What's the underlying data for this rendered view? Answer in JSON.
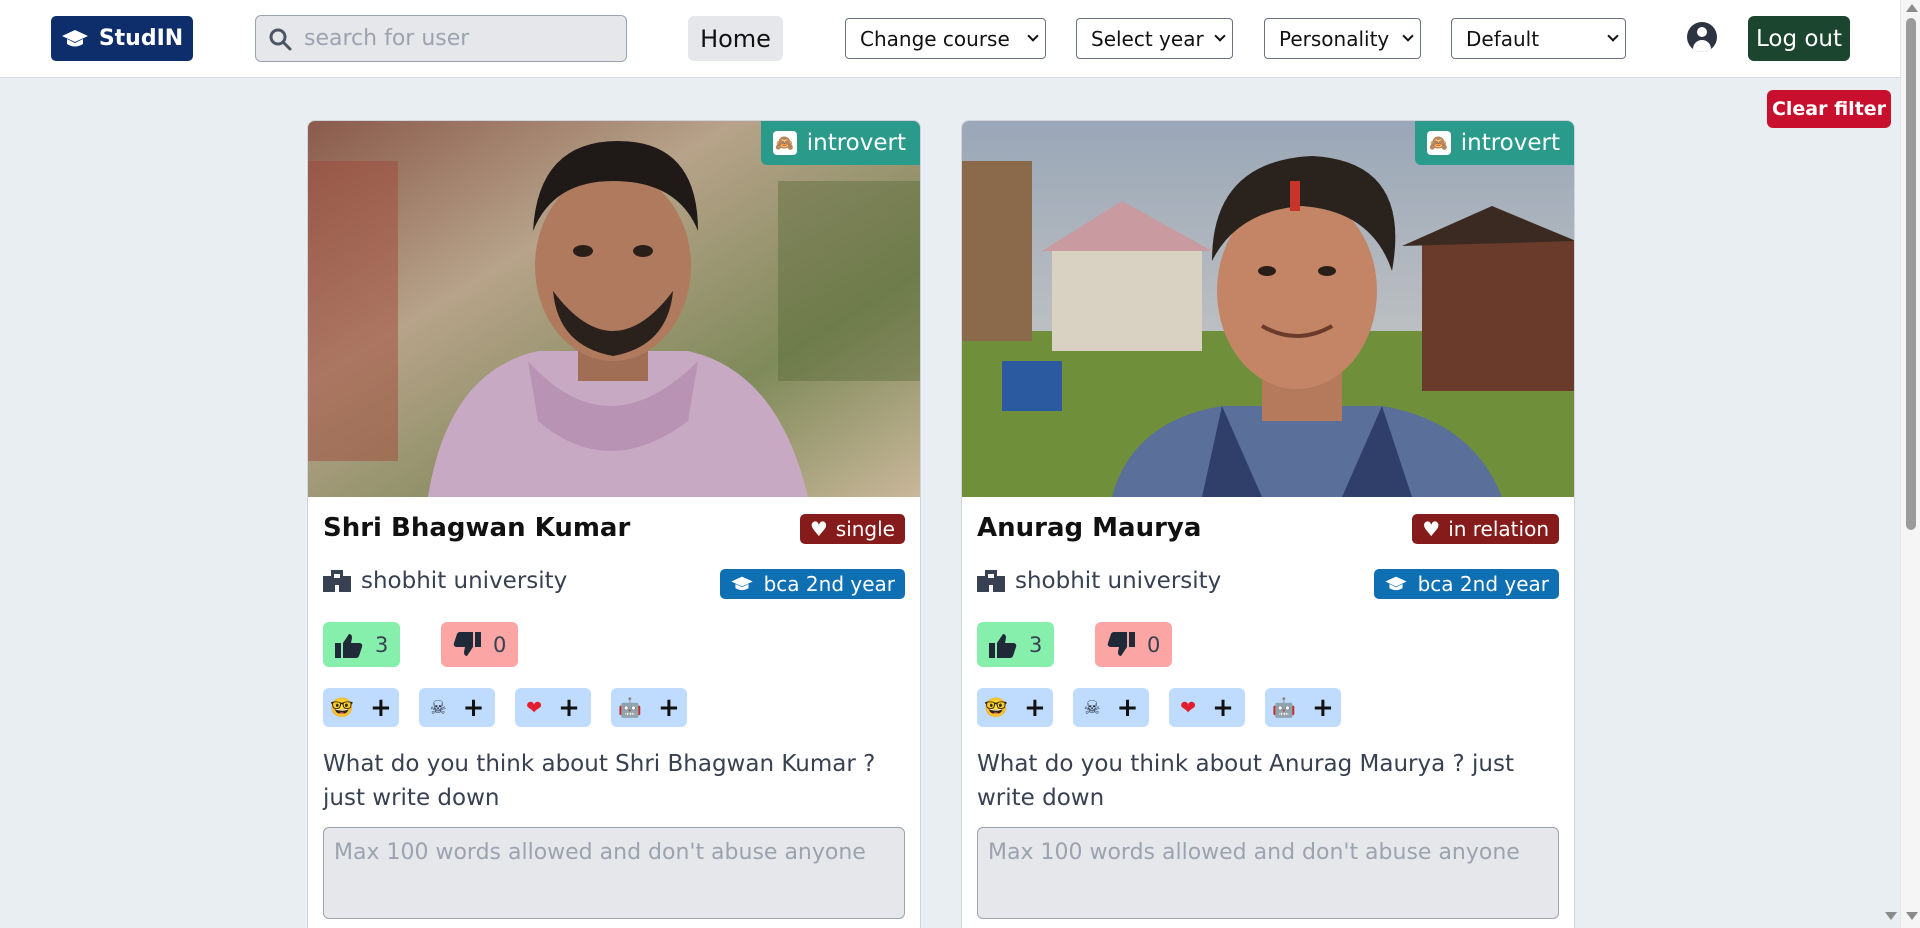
{
  "header": {
    "logo_text": "StudIN",
    "search_placeholder": "search for user",
    "home_label": "Home",
    "selects": [
      {
        "value": "Change course"
      },
      {
        "value": "Select year"
      },
      {
        "value": "Personality"
      },
      {
        "value": "Default"
      }
    ],
    "logout_label": "Log out"
  },
  "filters": {
    "clear_label": "Clear filter"
  },
  "cards": [
    {
      "personality": "introvert",
      "name": "Shri Bhagwan Kumar",
      "relationship": "single",
      "university": "shobhit university",
      "year": "bca 2nd year",
      "likes": "3",
      "dislikes": "0",
      "prompt": "What do you think about Shri Bhagwan Kumar ? just write down",
      "comment_placeholder": "Max 100 words allowed and don't abuse anyone"
    },
    {
      "personality": "introvert",
      "name": "Anurag Maurya",
      "relationship": "in relation",
      "university": "shobhit university",
      "year": "bca 2nd year",
      "likes": "3",
      "dislikes": "0",
      "prompt": "What do you think about Anurag Maurya ? just write down",
      "comment_placeholder": "Max 100 words allowed and don't abuse anyone"
    }
  ],
  "reactions": [
    {
      "icon": "nerd-face-icon",
      "glyph": "🤓",
      "add": "+"
    },
    {
      "icon": "skull-icon",
      "glyph": "☠",
      "add": "+"
    },
    {
      "icon": "heart-icon",
      "glyph": "❤",
      "add": "+"
    },
    {
      "icon": "robot-icon",
      "glyph": "🤖",
      "add": "+"
    }
  ],
  "colors": {
    "brand": "#0d2d6b",
    "personality_badge": "#2a9a8a",
    "relationship_badge": "#861b1b",
    "year_badge": "#0f6fb3",
    "logout": "#1c4530",
    "clear_filter": "#c8102e"
  }
}
